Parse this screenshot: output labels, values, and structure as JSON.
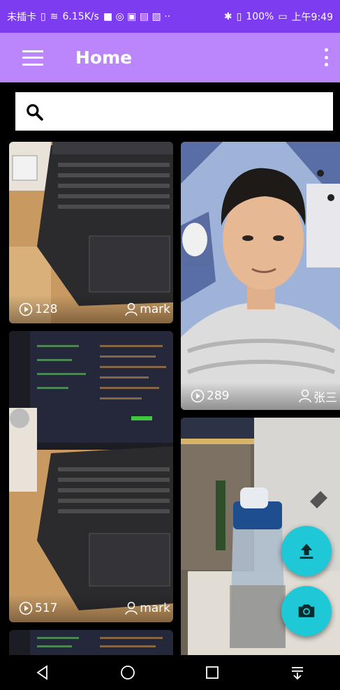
{
  "status_bar": {
    "carrier": "未插卡",
    "speed": "6.15K/s",
    "battery": "100%",
    "time": "上午9:49"
  },
  "app_bar": {
    "title": "Home",
    "menu_icon": "hamburger-icon",
    "overflow_icon": "more-vert-icon"
  },
  "search": {
    "value": "",
    "placeholder": "",
    "icon": "search-icon"
  },
  "videos": [
    {
      "views": "128",
      "author": "mark"
    },
    {
      "views": "289",
      "author": "张三"
    },
    {
      "views": "517",
      "author": "mark"
    },
    {
      "views": "",
      "author": ""
    },
    {
      "views": "",
      "author": ""
    }
  ],
  "fabs": {
    "upload_icon": "upload-icon",
    "camera_icon": "camera-icon",
    "color": "#1fc8d6"
  },
  "colors": {
    "status_bar": "#7d3cf0",
    "app_bar": "#bb86fc",
    "background": "#000000"
  }
}
